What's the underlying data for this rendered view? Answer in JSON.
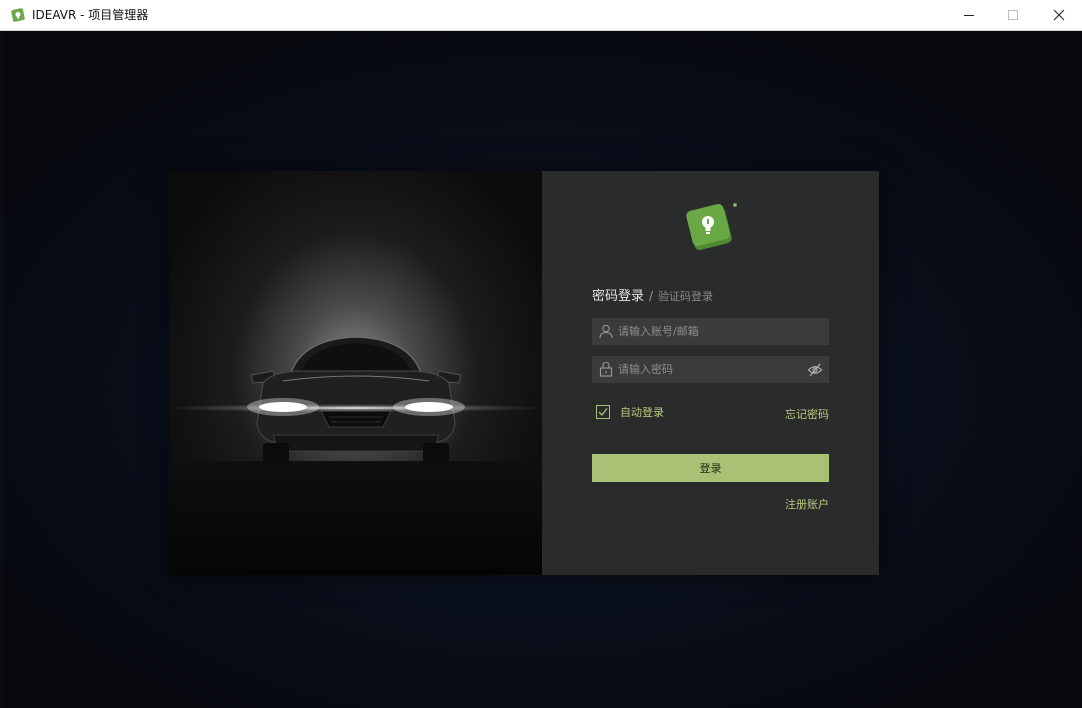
{
  "window": {
    "title": "IDEAVR - 项目管理器",
    "controls": [
      "minimize",
      "maximize",
      "close"
    ]
  },
  "login": {
    "tab_password": "密码登录",
    "tab_separator": "/",
    "tab_code": "验证码登录",
    "account_placeholder": "请输入账号/邮箱",
    "account_value": "",
    "password_placeholder": "请输入密码",
    "password_value": "",
    "auto_login_label": "自动登录",
    "auto_login_checked": true,
    "forgot_password": "忘记密码",
    "login_button": "登录",
    "register": "注册账户"
  },
  "icons": {
    "app_logo": "green-lightbulb-logo-icon",
    "account_field": "user-icon",
    "password_field": "lock-icon",
    "password_toggle": "eye-slash-icon"
  },
  "colors": {
    "accent": "#aac075",
    "accent_text": "#b8cc7e",
    "panel": "#2a2b2b",
    "field": "#3a3b3b",
    "logo_green": "#5f9a3c"
  }
}
